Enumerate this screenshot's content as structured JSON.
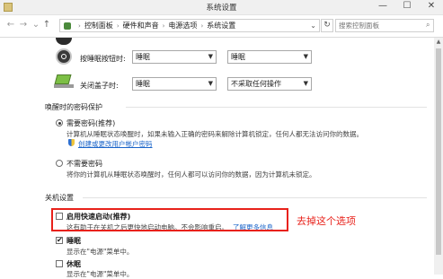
{
  "window": {
    "title": "系统设置",
    "minimize": "—",
    "maximize": "☐",
    "close": "✕"
  },
  "address_bar": {
    "back": "←",
    "forward": "→",
    "history": "⌄",
    "up": "↑",
    "breadcrumb": [
      "控制面板",
      "硬件和声音",
      "电源选项",
      "系统设置"
    ],
    "separator": "›",
    "dropdown": "⌄",
    "refresh": "↻",
    "search_placeholder": "搜索控制面板"
  },
  "power_rows": [
    {
      "label": "按睡眠按钮时:",
      "battery_value": "睡眠",
      "plugged_value": "睡眠",
      "icon": "sleep-button-icon"
    },
    {
      "label": "关闭盖子时:",
      "battery_value": "睡眠",
      "plugged_value": "不采取任何操作",
      "icon": "laptop-lid-icon"
    }
  ],
  "password_section": {
    "title": "唤醒时的密码保护",
    "require": {
      "label": "需要密码(推荐)",
      "desc": "计算机从睡眠状态唤醒时，如果未输入正确的密码来解除计算机锁定，任何人都无法访问你的数据。",
      "link": "创建或更改用户帐户密码",
      "checked": true
    },
    "no_require": {
      "label": "不需要密码",
      "desc": "将你的计算机从睡眠状态唤醒时，任何人都可以访问你的数据，因为计算机未锁定。",
      "checked": false
    }
  },
  "shutdown_section": {
    "title": "关机设置",
    "fast_startup": {
      "label": "启用快速启动(推荐)",
      "desc": "这有助于在关机之后更快地启动电脑。不会影响重启。",
      "link": "了解更多信息",
      "checked": false
    },
    "sleep": {
      "label": "睡眠",
      "desc": "显示在\"电源\"菜单中。",
      "checked": true,
      "check": "✔"
    },
    "hibernate": {
      "label": "休眠",
      "desc": "显示在\"电源\"菜单中。",
      "checked": false
    }
  },
  "annotation": {
    "text": "去掉这个选项",
    "color": "#e8211a"
  },
  "colors": {
    "link": "#1a64c9",
    "highlight": "#e8211a"
  }
}
